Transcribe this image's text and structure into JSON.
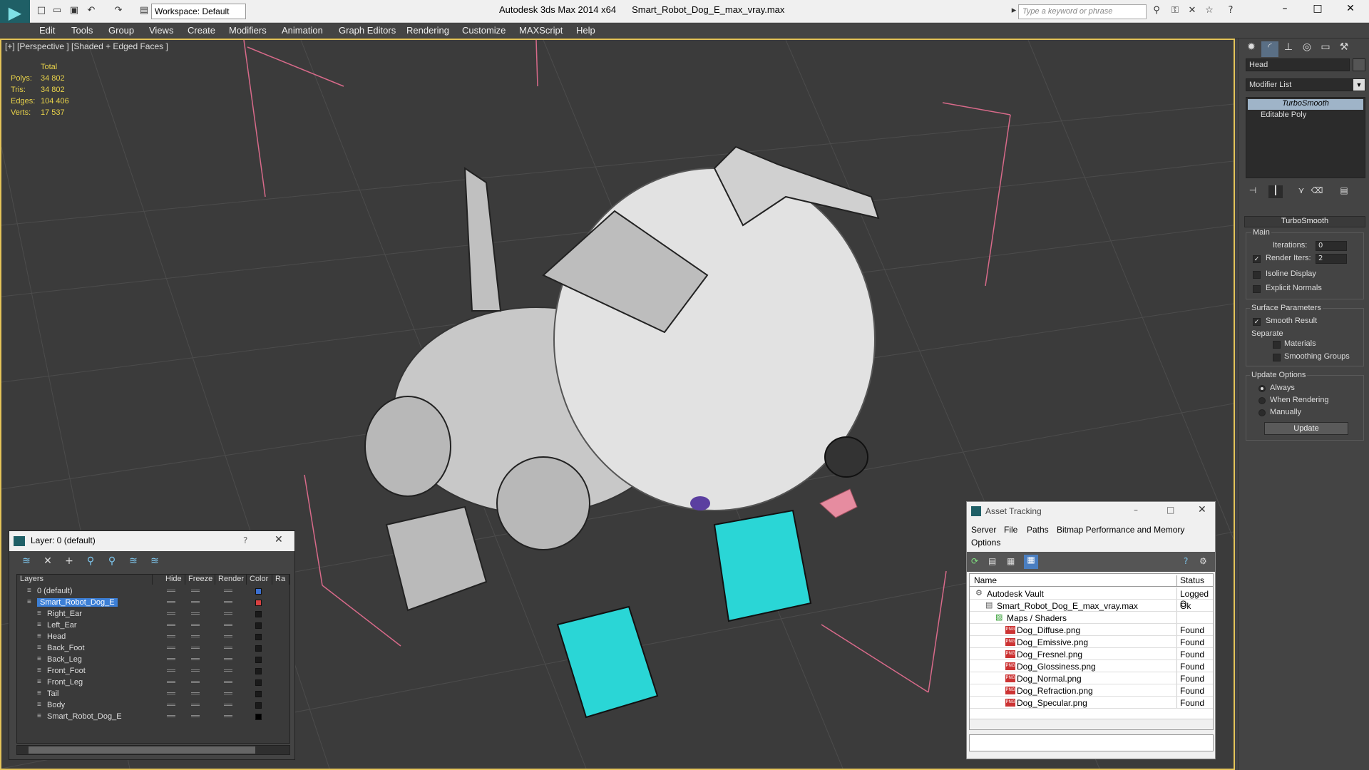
{
  "app": {
    "title": "Autodesk 3ds Max 2014 x64",
    "file": "Smart_Robot_Dog_E_max_vray.max",
    "workspace": "Workspace: Default",
    "search_placeholder": "Type a keyword or phrase"
  },
  "menu": [
    "Edit",
    "Tools",
    "Group",
    "Views",
    "Create",
    "Modifiers",
    "Animation",
    "Graph Editors",
    "Rendering",
    "Customize",
    "MAXScript",
    "Help"
  ],
  "viewport": {
    "label": "[+] [Perspective ] [Shaded + Edged Faces ]",
    "stats_header": "Total",
    "stats": [
      {
        "k": "Polys:",
        "v": "34 802"
      },
      {
        "k": "Tris:",
        "v": "34 802"
      },
      {
        "k": "Edges:",
        "v": "104 406"
      },
      {
        "k": "Verts:",
        "v": "17 537"
      }
    ]
  },
  "command_panel": {
    "object_name": "Head",
    "modifier_list": "Modifier List",
    "stack": [
      "TurboSmooth",
      "Editable Poly"
    ],
    "rollout": "TurboSmooth",
    "main": "Main",
    "iterations_label": "Iterations:",
    "iterations": "0",
    "render_iters_label": "Render Iters:",
    "render_iters": "2",
    "isoline": "Isoline Display",
    "explicit_normals": "Explicit Normals",
    "surface_params": "Surface Parameters",
    "smooth_result": "Smooth Result",
    "separate": "Separate",
    "materials": "Materials",
    "smoothing_groups": "Smoothing Groups",
    "update_options": "Update Options",
    "always": "Always",
    "when_rendering": "When Rendering",
    "manually": "Manually",
    "update": "Update"
  },
  "layer_window": {
    "title": "Layer: 0 (default)",
    "help": "?",
    "columns": [
      "Layers",
      "Hide",
      "Freeze",
      "Render",
      "Color",
      "Ra"
    ],
    "rows": [
      {
        "name": "0 (default)",
        "color": "#3b6fd0",
        "level": 0
      },
      {
        "name": "Smart_Robot_Dog_E",
        "color": "#d84040",
        "level": 0,
        "selected": true
      },
      {
        "name": "Right_Ear",
        "color": "#1a1a1a",
        "level": 1
      },
      {
        "name": "Left_Ear",
        "color": "#1a1a1a",
        "level": 1
      },
      {
        "name": "Head",
        "color": "#1a1a1a",
        "level": 1
      },
      {
        "name": "Back_Foot",
        "color": "#1a1a1a",
        "level": 1
      },
      {
        "name": "Back_Leg",
        "color": "#1a1a1a",
        "level": 1
      },
      {
        "name": "Front_Foot",
        "color": "#1a1a1a",
        "level": 1
      },
      {
        "name": "Front_Leg",
        "color": "#1a1a1a",
        "level": 1
      },
      {
        "name": "Tail",
        "color": "#1a1a1a",
        "level": 1
      },
      {
        "name": "Body",
        "color": "#1a1a1a",
        "level": 1
      },
      {
        "name": "Smart_Robot_Dog_E",
        "color": "#000000",
        "level": 1
      }
    ]
  },
  "asset_window": {
    "title": "Asset Tracking",
    "menu": [
      "Server",
      "File",
      "Paths",
      "Bitmap Performance and Memory",
      "Options"
    ],
    "columns": [
      "Name",
      "Status"
    ],
    "rows": [
      {
        "name": "Autodesk Vault",
        "status": "Logged O",
        "level": 0
      },
      {
        "name": "Smart_Robot_Dog_E_max_vray.max",
        "status": "Ok",
        "level": 1
      },
      {
        "name": "Maps / Shaders",
        "status": "",
        "level": 2
      },
      {
        "name": "Dog_Diffuse.png",
        "status": "Found",
        "level": 3
      },
      {
        "name": "Dog_Emissive.png",
        "status": "Found",
        "level": 3
      },
      {
        "name": "Dog_Fresnel.png",
        "status": "Found",
        "level": 3
      },
      {
        "name": "Dog_Glossiness.png",
        "status": "Found",
        "level": 3
      },
      {
        "name": "Dog_Normal.png",
        "status": "Found",
        "level": 3
      },
      {
        "name": "Dog_Refraction.png",
        "status": "Found",
        "level": 3
      },
      {
        "name": "Dog_Specular.png",
        "status": "Found",
        "level": 3
      }
    ]
  }
}
